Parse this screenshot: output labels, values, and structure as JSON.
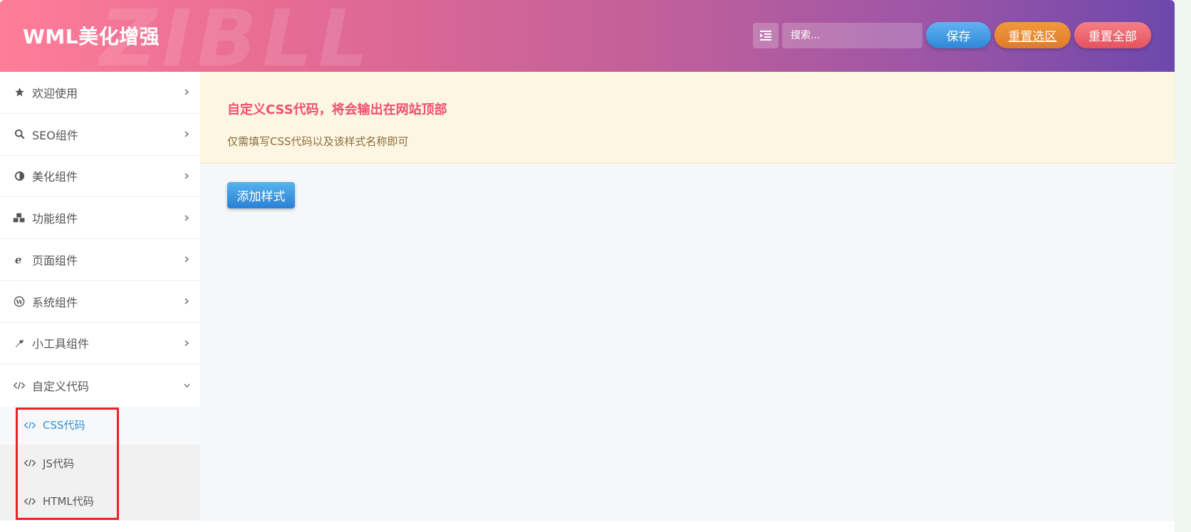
{
  "header": {
    "brand": "WML美化增强",
    "watermark": "ZIBLL",
    "search_placeholder": "搜索...",
    "buttons": {
      "save": "保存",
      "reset_section": "重置选区",
      "reset_all": "重置全部"
    }
  },
  "sidebar": {
    "items": [
      {
        "label": "欢迎使用",
        "icon": "star-icon"
      },
      {
        "label": "SEO组件",
        "icon": "search-icon"
      },
      {
        "label": "美化组件",
        "icon": "adjust-icon"
      },
      {
        "label": "功能组件",
        "icon": "cubes-icon"
      },
      {
        "label": "页面组件",
        "icon": "internet-explorer-icon"
      },
      {
        "label": "系统组件",
        "icon": "wordpress-icon"
      },
      {
        "label": "小工具组件",
        "icon": "wrench-icon"
      },
      {
        "label": "自定义代码",
        "icon": "code-icon"
      }
    ],
    "submenu": [
      {
        "label": "CSS代码",
        "icon": "code-icon",
        "active": true
      },
      {
        "label": "JS代码",
        "icon": "code-icon"
      },
      {
        "label": "HTML代码",
        "icon": "code-icon"
      }
    ]
  },
  "content": {
    "notice_title": "自定义CSS代码，将会输出在网站顶部",
    "notice_desc": "仅需填写CSS代码以及该样式名称即可",
    "add_button": "添加样式"
  },
  "colors": {
    "accent_pink": "#f0506e",
    "active_blue": "#2e90da",
    "highlight_red": "#e8232b"
  }
}
